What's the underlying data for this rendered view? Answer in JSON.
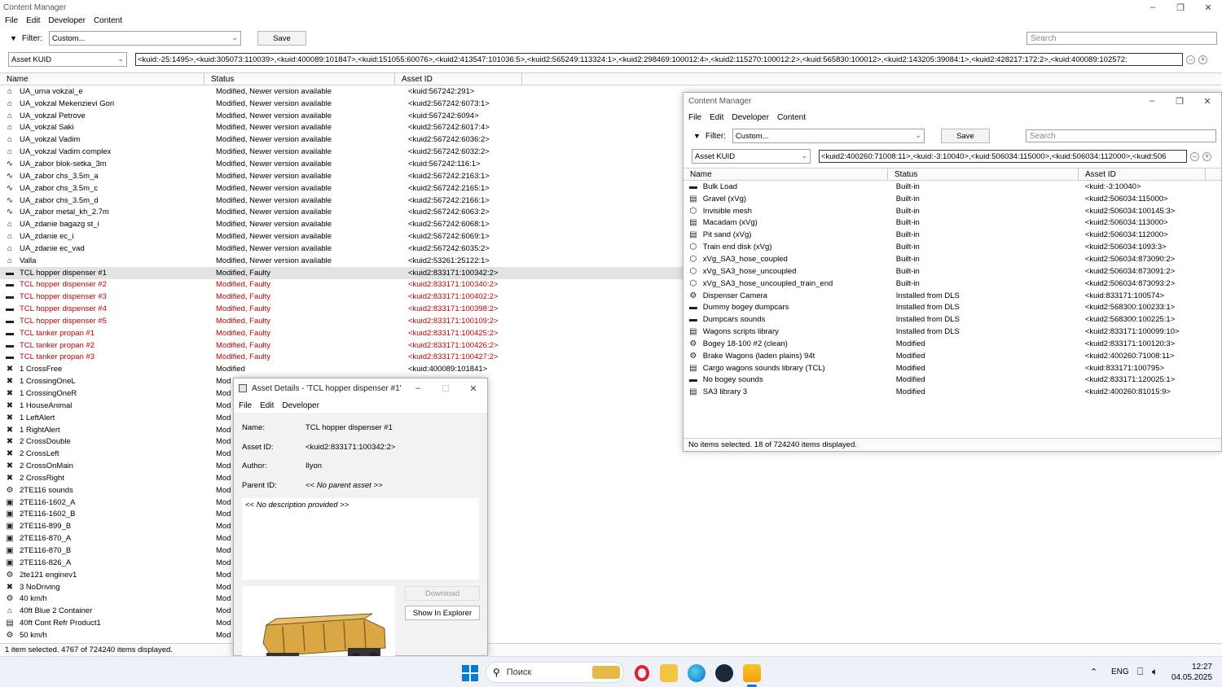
{
  "main": {
    "title": "Content Manager",
    "menu": [
      "File",
      "Edit",
      "Developer",
      "Content"
    ],
    "filter_label": "Filter:",
    "filter_value": "Custom...",
    "save_label": "Save",
    "search_placeholder": "Search",
    "kuid_combo": "Asset KUID",
    "kuid_list": "<kuid:-25:1495>,<kuid:305073:110039>,<kuid:400089:101847>,<kuid:151055:60076>,<kuid2:413547:101036:5>,<kuid2:565249:113324:1>,<kuid2:298469:100012:4>,<kuid2:115270:100012:2>,<kuid:565830:100012>,<kuid2:143205:39084:1>,<kuid2:428217:172:2>,<kuid:400089:102572:",
    "columns": [
      "Name",
      "Status",
      "Asset ID"
    ],
    "rows": [
      {
        "icon": "house-icon",
        "name": "UA_urna vokzal_e",
        "status": "Modified, Newer version available",
        "id": "<kuid:567242:291>"
      },
      {
        "icon": "house-icon",
        "name": "UA_vokzal Mekenzievi Gori",
        "status": "Modified, Newer version available",
        "id": "<kuid2:567242:6073:1>"
      },
      {
        "icon": "house-icon",
        "name": "UA_vokzal Petrove",
        "status": "Modified, Newer version available",
        "id": "<kuid:567242:6094>"
      },
      {
        "icon": "house-icon",
        "name": "UA_vokzal Saki",
        "status": "Modified, Newer version available",
        "id": "<kuid2:567242:6017:4>"
      },
      {
        "icon": "house-icon",
        "name": "UA_vokzal Vadim",
        "status": "Modified, Newer version available",
        "id": "<kuid2:567242:6036:2>"
      },
      {
        "icon": "house-icon",
        "name": "UA_vokzal Vadim complex",
        "status": "Modified, Newer version available",
        "id": "<kuid2:567242:6032:2>"
      },
      {
        "icon": "spline-icon",
        "name": "UA_zabor blok-setka_3m",
        "status": "Modified, Newer version available",
        "id": "<kuid:567242:116:1>"
      },
      {
        "icon": "spline-icon",
        "name": "UA_zabor chs_3.5m_a",
        "status": "Modified, Newer version available",
        "id": "<kuid2:567242:2163:1>"
      },
      {
        "icon": "spline-icon",
        "name": "UA_zabor chs_3.5m_c",
        "status": "Modified, Newer version available",
        "id": "<kuid2:567242:2165:1>"
      },
      {
        "icon": "spline-icon",
        "name": "UA_zabor chs_3.5m_d",
        "status": "Modified, Newer version available",
        "id": "<kuid2:567242:2166:1>"
      },
      {
        "icon": "spline-icon",
        "name": "UA_zabor metal_kh_2.7m",
        "status": "Modified, Newer version available",
        "id": "<kuid2:567242:6063:2>"
      },
      {
        "icon": "house-icon",
        "name": "UA_zdanie bagazg st_i",
        "status": "Modified, Newer version available",
        "id": "<kuid2:567242:6068:1>"
      },
      {
        "icon": "house-icon",
        "name": "UA_zdanie ec_i",
        "status": "Modified, Newer version available",
        "id": "<kuid2:567242:6069:1>"
      },
      {
        "icon": "house-icon",
        "name": "UA_zdanie ec_vad",
        "status": "Modified, Newer version available",
        "id": "<kuid2:567242:6035:2>"
      },
      {
        "icon": "house-icon",
        "name": "Valla",
        "status": "Modified, Newer version available",
        "id": "<kuid2:53261:25122:1>"
      },
      {
        "icon": "wagon-icon",
        "name": "TCL hopper dispenser #1",
        "status": "Modified, Faulty",
        "id": "<kuid2:833171:100342:2>",
        "sel": true
      },
      {
        "icon": "wagon-icon",
        "name": "TCL hopper dispenser #2",
        "status": "Modified, Faulty",
        "id": "<kuid2:833171:100340:2>",
        "red": true
      },
      {
        "icon": "wagon-icon",
        "name": "TCL hopper dispenser #3",
        "status": "Modified, Faulty",
        "id": "<kuid2:833171:100402:2>",
        "red": true
      },
      {
        "icon": "wagon-icon",
        "name": "TCL hopper dispenser #4",
        "status": "Modified, Faulty",
        "id": "<kuid2:833171:100398:2>",
        "red": true
      },
      {
        "icon": "wagon-icon",
        "name": "TCL hopper dispenser #5",
        "status": "Modified, Faulty",
        "id": "<kuid2:833171:100109:2>",
        "red": true
      },
      {
        "icon": "wagon-icon",
        "name": "TCL tanker propan #1",
        "status": "Modified, Faulty",
        "id": "<kuid2:833171:100425:2>",
        "red": true
      },
      {
        "icon": "wagon-icon",
        "name": "TCL tanker propan #2",
        "status": "Modified, Faulty",
        "id": "<kuid2:833171:100426:2>",
        "red": true
      },
      {
        "icon": "wagon-icon",
        "name": "TCL tanker propan #3",
        "status": "Modified, Faulty",
        "id": "<kuid2:833171:100427:2>",
        "red": true
      },
      {
        "icon": "crossing-icon",
        "name": "1 CrossFree",
        "status": "Modified",
        "id": "<kuid:400089:101841>"
      },
      {
        "icon": "crossing-icon",
        "name": "1 CrossingOneL",
        "status": "Mod",
        "id": ""
      },
      {
        "icon": "crossing-icon",
        "name": "1 CrossingOneR",
        "status": "Mod",
        "id": ""
      },
      {
        "icon": "crossing-icon",
        "name": "1 HouseAnimal",
        "status": "Mod",
        "id": ""
      },
      {
        "icon": "crossing-icon",
        "name": "1 LeftAlert",
        "status": "Mod",
        "id": ""
      },
      {
        "icon": "crossing-icon",
        "name": "1 RightAlert",
        "status": "Mod",
        "id": ""
      },
      {
        "icon": "crossing-icon",
        "name": "2 CrossDouble",
        "status": "Mod",
        "id": ""
      },
      {
        "icon": "crossing-icon",
        "name": "2 CrossLeft",
        "status": "Mod",
        "id": ""
      },
      {
        "icon": "crossing-icon",
        "name": "2 CrossOnMain",
        "status": "Mod",
        "id": ""
      },
      {
        "icon": "crossing-icon",
        "name": "2 CrossRight",
        "status": "Mod",
        "id": ""
      },
      {
        "icon": "sound-icon",
        "name": "2TE116 sounds",
        "status": "Mod",
        "id": ""
      },
      {
        "icon": "loco-icon",
        "name": "2TE116-1602_A",
        "status": "Mod",
        "id": ""
      },
      {
        "icon": "loco-icon",
        "name": "2TE116-1602_B",
        "status": "Mod",
        "id": ""
      },
      {
        "icon": "loco-icon",
        "name": "2TE116-899_B",
        "status": "Mod",
        "id": ""
      },
      {
        "icon": "loco-icon",
        "name": "2TE116-870_A",
        "status": "Mod",
        "id": ""
      },
      {
        "icon": "loco-icon",
        "name": "2TE116-870_B",
        "status": "Mod",
        "id": ""
      },
      {
        "icon": "loco-icon",
        "name": "2TE116-826_A",
        "status": "Mod",
        "id": ""
      },
      {
        "icon": "sound-icon",
        "name": "2te121 enginev1",
        "status": "Mod",
        "id": ""
      },
      {
        "icon": "crossing-icon",
        "name": "3 NoDriving",
        "status": "Mod",
        "id": ""
      },
      {
        "icon": "gear-icon",
        "name": "40 km/h",
        "status": "Mod",
        "id": ""
      },
      {
        "icon": "house-icon",
        "name": "40ft Blue 2 Container",
        "status": "Mod",
        "id": ""
      },
      {
        "icon": "library-icon",
        "name": "40ft Cont Refr Product1",
        "status": "Mod",
        "id": ""
      },
      {
        "icon": "gear-icon",
        "name": "50 km/h",
        "status": "Mod",
        "id": ""
      }
    ],
    "status_text": "1 item selected. 4767 of 724240 items displayed."
  },
  "cm2": {
    "title": "Content Manager",
    "menu": [
      "File",
      "Edit",
      "Developer",
      "Content"
    ],
    "filter_label": "Filter:",
    "filter_value": "Custom...",
    "save_label": "Save",
    "search_placeholder": "Search",
    "kuid_combo": "Asset KUID",
    "kuid_list": "<kuid2:400260:71008:11>,<kuid:-3:10040>,<kuid:506034:115000>,<kuid:506034:112000>,<kuid:506",
    "columns": [
      "Name",
      "Status",
      "Asset ID"
    ],
    "rows": [
      {
        "icon": "wagon-icon",
        "name": "Bulk Load",
        "status": "Built-in",
        "id": "<kuid:-3:10040>"
      },
      {
        "icon": "library-icon",
        "name": "Gravel (xVg)",
        "status": "Built-in",
        "id": "<kuid2:506034:115000>"
      },
      {
        "icon": "cube-icon",
        "name": "Invisible mesh",
        "status": "Built-in",
        "id": "<kuid2:506034:100145:3>"
      },
      {
        "icon": "library-icon",
        "name": "Macadam (xVg)",
        "status": "Built-in",
        "id": "<kuid2:506034:113000>"
      },
      {
        "icon": "library-icon",
        "name": "Pit sand (xVg)",
        "status": "Built-in",
        "id": "<kuid2:506034:112000>"
      },
      {
        "icon": "cube-icon",
        "name": "Train end disk (xVg)",
        "status": "Built-in",
        "id": "<kuid2:506034:1093:3>"
      },
      {
        "icon": "cube-icon",
        "name": "xVg_SA3_hose_coupled",
        "status": "Built-in",
        "id": "<kuid2:506034:873090:2>"
      },
      {
        "icon": "cube-icon",
        "name": "xVg_SA3_hose_uncoupled",
        "status": "Built-in",
        "id": "<kuid2:506034:873091:2>"
      },
      {
        "icon": "cube-icon",
        "name": "xVg_SA3_hose_uncoupled_train_end",
        "status": "Built-in",
        "id": "<kuid2:506034:873093:2>"
      },
      {
        "icon": "sound-icon",
        "name": "Dispenser Camera",
        "status": "Installed from DLS",
        "id": "<kuid:833171:100574>"
      },
      {
        "icon": "wagon-icon",
        "name": "Dummy bogey dumpcars",
        "status": "Installed from DLS",
        "id": "<kuid2:568300:100233:1>"
      },
      {
        "icon": "wagon-icon",
        "name": "Dumpcars sounds",
        "status": "Installed from DLS",
        "id": "<kuid2:568300:100225:1>"
      },
      {
        "icon": "library-icon",
        "name": "Wagons scripts library",
        "status": "Installed from DLS",
        "id": "<kuid2:833171:100099:10>"
      },
      {
        "icon": "sound-icon",
        "name": "Bogey 18-100 #2 (clean)",
        "status": "Modified",
        "id": "<kuid2:833171:100120:3>"
      },
      {
        "icon": "sound-icon",
        "name": "Brake Wagons (laden plains) 94t",
        "status": "Modified",
        "id": "<kuid2:400260:71008:11>"
      },
      {
        "icon": "library-icon",
        "name": "Cargo wagons sounds library (TCL)",
        "status": "Modified",
        "id": "<kuid:833171:100795>"
      },
      {
        "icon": "wagon-icon",
        "name": "No bogey sounds",
        "status": "Modified",
        "id": "<kuid2:833171:120025:1>"
      },
      {
        "icon": "library-icon",
        "name": "SA3 library 3",
        "status": "Modified",
        "id": "<kuid2:400260:81015:9>"
      }
    ],
    "status_text": "No items selected. 18 of 724240 items displayed."
  },
  "details": {
    "title": "Asset Details - 'TCL hopper dispenser #1'",
    "menu": [
      "File",
      "Edit",
      "Developer"
    ],
    "name_label": "Name:",
    "name_value": "TCL hopper dispenser #1",
    "id_label": "Asset ID:",
    "id_value": "<kuid2:833171:100342:2>",
    "author_label": "Author:",
    "author_value": "Ilyon",
    "parent_label": "Parent ID:",
    "parent_value": "<< No parent asset >>",
    "description": "<< No description provided >>",
    "download_label": "Download",
    "explorer_label": "Show In Explorer"
  },
  "taskbar": {
    "search_placeholder": "Поиск",
    "lang": "ENG",
    "time": "12:27",
    "date": "04.05.2025"
  },
  "colors": {
    "faulty": "#c00000",
    "selected_row": "#e3e3e3",
    "taskbar": "#eef1f7"
  }
}
